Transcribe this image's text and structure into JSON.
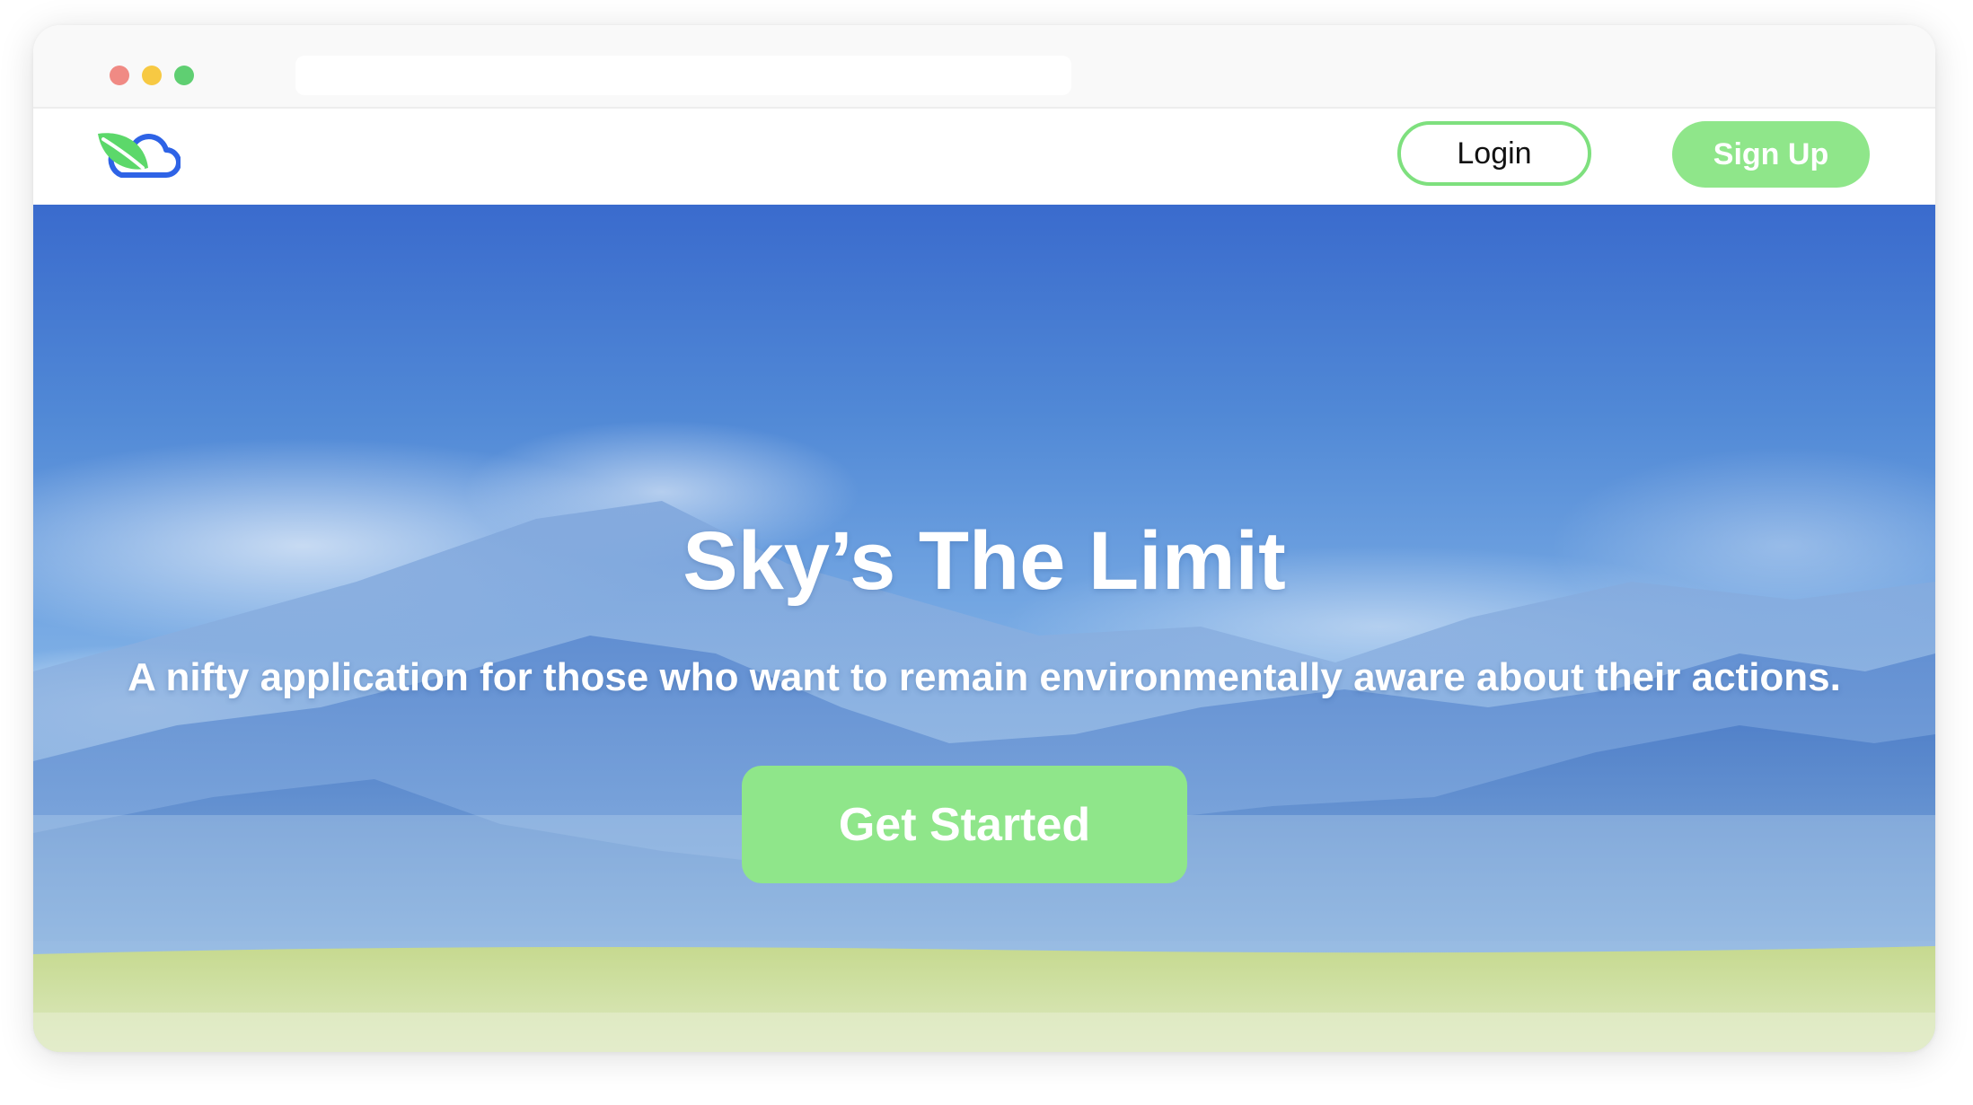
{
  "browser": {
    "controls": [
      "close",
      "minimize",
      "maximize"
    ],
    "address_value": ""
  },
  "navbar": {
    "logo_icon": "leaf-cloud-logo-icon",
    "login_label": "Login",
    "signup_label": "Sign Up"
  },
  "hero": {
    "title": "Sky’s The Limit",
    "subtitle": "A nifty application for those who want to remain environmentally aware about their actions.",
    "cta_label": "Get Started"
  },
  "colors": {
    "accent_green": "#8fe68a",
    "login_border": "#7ee07e",
    "sky_top": "#3b6fcf",
    "sky_mid": "#6fa3e0",
    "grass": "#c9dc9a"
  }
}
